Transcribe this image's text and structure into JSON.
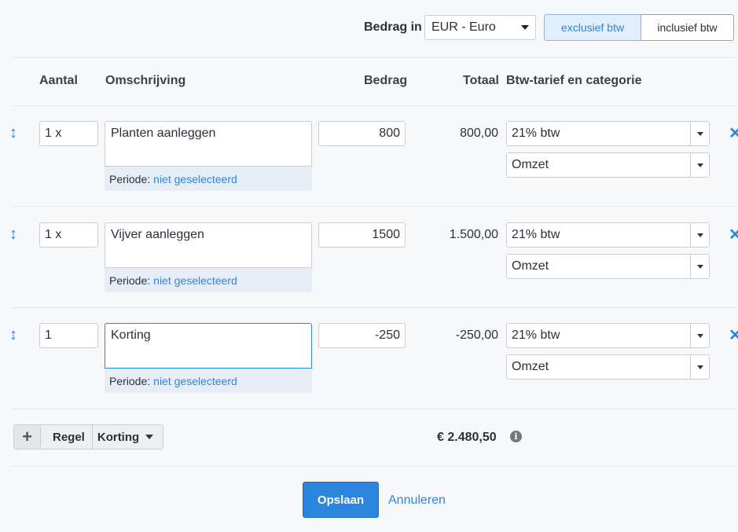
{
  "header": {
    "amount_in_label": "Bedrag in",
    "currency": "EUR - Euro",
    "vat_toggle": {
      "exclusive": "exclusief btw",
      "inclusive": "inclusief btw",
      "selected": "exclusief btw"
    }
  },
  "columns": {
    "quantity": "Aantal",
    "description": "Omschrijving",
    "amount": "Bedrag",
    "total": "Totaal",
    "vat_category": "Btw-tarief en categorie"
  },
  "lines": [
    {
      "quantity": "1 x",
      "description": "Planten aanleggen",
      "period_label": "Periode:",
      "period_value": "niet geselecteerd",
      "amount": "800",
      "total": "800,00",
      "vat": "21% btw",
      "category": "Omzet"
    },
    {
      "quantity": "1 x",
      "description": "Vijver aanleggen",
      "period_label": "Periode:",
      "period_value": "niet geselecteerd",
      "amount": "1500",
      "total": "1.500,00",
      "vat": "21% btw",
      "category": "Omzet"
    },
    {
      "quantity": "1",
      "description": "Korting",
      "period_label": "Periode:",
      "period_value": "niet geselecteerd",
      "amount": "-250",
      "total": "-250,00",
      "vat": "21% btw",
      "category": "Omzet"
    }
  ],
  "footer": {
    "add_symbol": "+",
    "add_line_label": "Regel",
    "add_discount_label": "Korting",
    "grand_total": "€ 2.480,50",
    "info_symbol": "i"
  },
  "actions": {
    "save": "Opslaan",
    "cancel": "Annuleren"
  },
  "icons": {
    "drag": "drag-vertical-icon",
    "delete": "close-icon",
    "info": "info-icon"
  },
  "colors": {
    "accent": "#2d86dd",
    "background": "#f7f8fa",
    "period_bg": "#e7edf5"
  }
}
